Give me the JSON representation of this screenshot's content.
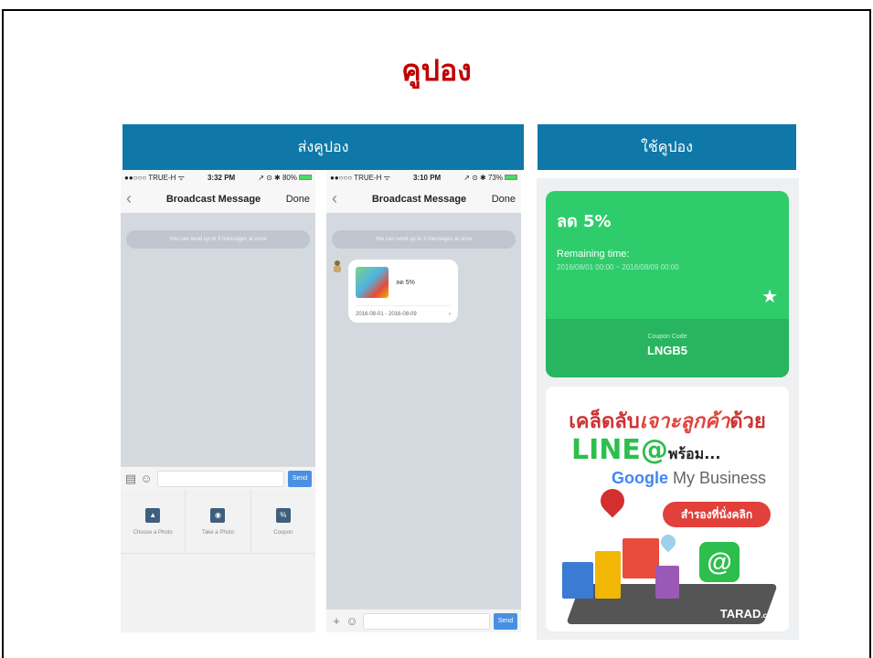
{
  "title": "คูปอง",
  "headers": {
    "send": "ส่งคูปอง",
    "use": "ใช้คูปอง"
  },
  "phone1": {
    "status": {
      "carrier": "●●○○○ TRUE-H ᯤ",
      "time": "3:32 PM",
      "battery": "↗ ⊙ ✱ 80%"
    },
    "nav": {
      "back": "‹",
      "title": "Broadcast Message",
      "done": "Done"
    },
    "notice": "You can send up to 3 messages at once",
    "send_label": "Send",
    "tray": [
      {
        "label": "Choose a Photo",
        "icon": "image-icon"
      },
      {
        "label": "Take a Photo",
        "icon": "camera-icon"
      },
      {
        "label": "Coupon",
        "icon": "coupon-icon"
      }
    ]
  },
  "phone2": {
    "status": {
      "carrier": "●●○○○ TRUE-H ᯤ",
      "time": "3:10 PM",
      "battery": "↗ ⊙ ✱ 73%"
    },
    "nav": {
      "back": "‹",
      "title": "Broadcast Message",
      "done": "Done"
    },
    "notice": "You can send up to 3 messages at once",
    "bubble": {
      "discount": "ลด 5%",
      "range": "2016-08-01 - 2016-08-09",
      "chevron": "›"
    },
    "send_label": "Send"
  },
  "coupon": {
    "discount": "ลด 5%",
    "remaining_label": "Remaining time:",
    "range": "2016/08/01 00:00 ~ 2016/08/09 00:00",
    "code_label": "Coupon Code",
    "code": "LNGB5",
    "star": "★"
  },
  "ad": {
    "line1_a": "เคล็ดลับ",
    "line1_b": "เจาะลูกค้า",
    "line1_c": "ด้วย",
    "line2_a": "LINE@",
    "line2_b": "พร้อม...",
    "line3_a": "Google",
    "line3_b": " My Business",
    "button": "สำรองที่นั่งคลิก",
    "at": "@",
    "brand": "TARAD",
    "brand_suffix": ".com"
  },
  "colors": {
    "title": "#c00000",
    "header": "#0f78a8",
    "coupon": "#2fcc6c",
    "send": "#4a90e2"
  }
}
